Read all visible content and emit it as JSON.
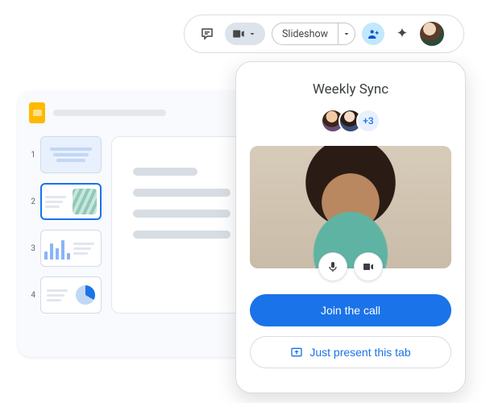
{
  "toolbar": {
    "slideshow_label": "Slideshow"
  },
  "meet": {
    "title": "Weekly Sync",
    "extra_count": "+3",
    "join_label": "Join the call",
    "present_label": "Just present this tab"
  },
  "thumbs": [
    "1",
    "2",
    "3",
    "4"
  ]
}
